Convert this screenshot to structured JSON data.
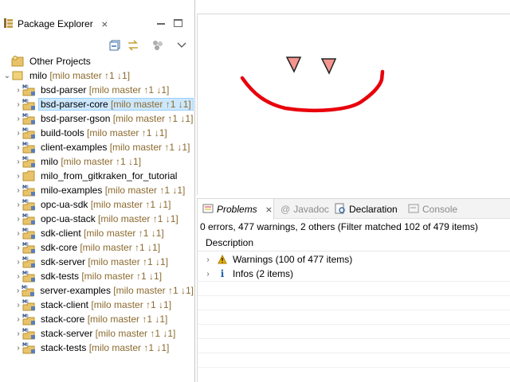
{
  "left_view": {
    "tab_label": "Package Explorer",
    "close_glyph": "⨯",
    "toolbar_icons": [
      "collapse-all-icon",
      "link-with-editor-icon",
      "focus-active-task-icon",
      "view-menu-icon"
    ]
  },
  "tree": {
    "rows": [
      {
        "name": "Other Projects",
        "deco": "",
        "kind": "working-set",
        "chevron": "",
        "indent": 0
      },
      {
        "name": "milo",
        "deco": " [milo master ↑1 ↓1]",
        "kind": "root",
        "chevron": "⌄",
        "indent": 0
      },
      {
        "name": "bsd-parser",
        "deco": " [milo master ↑1 ↓1]",
        "kind": "maven",
        "chevron": "›",
        "indent": 1
      },
      {
        "name": "bsd-parser-core",
        "deco": " [milo master ↑1 ↓1]",
        "kind": "maven",
        "chevron": "›",
        "indent": 1,
        "selected": true
      },
      {
        "name": "bsd-parser-gson",
        "deco": " [milo master ↑1 ↓1]",
        "kind": "maven",
        "chevron": "›",
        "indent": 1
      },
      {
        "name": "build-tools",
        "deco": " [milo master ↑1 ↓1]",
        "kind": "maven",
        "chevron": "›",
        "indent": 1
      },
      {
        "name": "client-examples",
        "deco": " [milo master ↑1 ↓1]",
        "kind": "maven",
        "chevron": "›",
        "indent": 1
      },
      {
        "name": "milo",
        "deco": " [milo master ↑1 ↓1]",
        "kind": "maven",
        "chevron": "›",
        "indent": 1
      },
      {
        "name": "milo_from_gitkraken_for_tutorial",
        "deco": "",
        "kind": "folder",
        "chevron": "›",
        "indent": 1
      },
      {
        "name": "milo-examples",
        "deco": " [milo master ↑1 ↓1]",
        "kind": "maven",
        "chevron": "›",
        "indent": 1
      },
      {
        "name": "opc-ua-sdk",
        "deco": " [milo master ↑1 ↓1]",
        "kind": "maven",
        "chevron": "›",
        "indent": 1
      },
      {
        "name": "opc-ua-stack",
        "deco": " [milo master ↑1 ↓1]",
        "kind": "maven",
        "chevron": "›",
        "indent": 1
      },
      {
        "name": "sdk-client",
        "deco": " [milo master ↑1 ↓1]",
        "kind": "maven",
        "chevron": "›",
        "indent": 1
      },
      {
        "name": "sdk-core",
        "deco": " [milo master ↑1 ↓1]",
        "kind": "maven",
        "chevron": "›",
        "indent": 1
      },
      {
        "name": "sdk-server",
        "deco": " [milo master ↑1 ↓1]",
        "kind": "maven",
        "chevron": "›",
        "indent": 1
      },
      {
        "name": "sdk-tests",
        "deco": " [milo master ↑1 ↓1]",
        "kind": "maven",
        "chevron": "›",
        "indent": 1
      },
      {
        "name": "server-examples",
        "deco": " [milo master ↑1 ↓1]",
        "kind": "maven",
        "chevron": "›",
        "indent": 1
      },
      {
        "name": "stack-client",
        "deco": " [milo master ↑1 ↓1]",
        "kind": "maven",
        "chevron": "›",
        "indent": 1
      },
      {
        "name": "stack-core",
        "deco": " [milo master ↑1 ↓1]",
        "kind": "maven",
        "chevron": "›",
        "indent": 1
      },
      {
        "name": "stack-server",
        "deco": " [milo master ↑1 ↓1]",
        "kind": "maven",
        "chevron": "›",
        "indent": 1
      },
      {
        "name": "stack-tests",
        "deco": " [milo master ↑1 ↓1]",
        "kind": "maven",
        "chevron": "›",
        "indent": 1
      }
    ]
  },
  "problems_view": {
    "tabs": [
      {
        "label": "Problems",
        "icon": "problems-icon",
        "active": true,
        "close": "⨯"
      },
      {
        "label": "Javadoc",
        "icon": "javadoc-icon",
        "active": false
      },
      {
        "label": "Declaration",
        "icon": "declaration-icon",
        "active": false
      },
      {
        "label": "Console",
        "icon": "console-icon",
        "active": false
      }
    ],
    "summary": "0 errors, 477 warnings, 2 others (Filter matched 102 of 479 items)",
    "column_header": "Description",
    "groups": [
      {
        "label": "Warnings (100 of 477 items)",
        "icon": "warning-icon"
      },
      {
        "label": "Infos (2 items)",
        "icon": "info-icon"
      }
    ]
  },
  "colors": {
    "drawing_red": "#e8000b",
    "triangle_fill": "#f4958f",
    "selection": "#cce8ff",
    "git_decoration": "#8b6a2f"
  }
}
